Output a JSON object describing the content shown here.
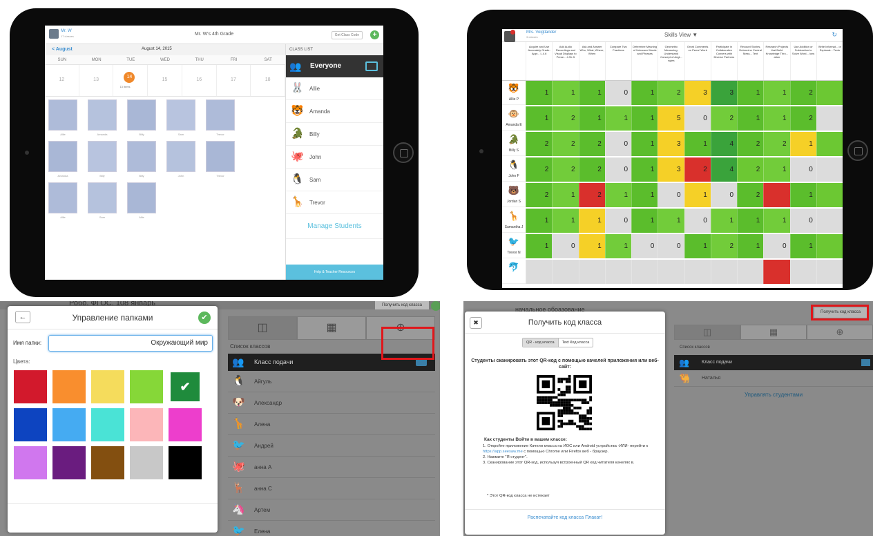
{
  "tl": {
    "teacher": "Mr. W",
    "teacher_sub": "17 classes",
    "title": "Mr. W's 4th Grade",
    "get_code": "Get Class Code",
    "back": "< August",
    "date": "August 14, 2015",
    "days": [
      "SUN",
      "MON",
      "TUE",
      "WED",
      "THU",
      "FRI",
      "SAT"
    ],
    "dates": [
      "12",
      "13",
      "14",
      "15",
      "16",
      "17",
      "18"
    ],
    "items": "13 items",
    "class_list": "CLASS LIST",
    "everyone": "Everyone",
    "students": [
      "Allie",
      "Amanda",
      "Billy",
      "John",
      "Sam",
      "Trevor"
    ],
    "student_icons": [
      "🐰",
      "🐯",
      "🐊",
      "🐙",
      "🐧",
      "🦒"
    ],
    "manage": "Manage Students",
    "help": "Help & Teacher Resources",
    "thumb_names": [
      "Allie",
      "Amanda",
      "Billy",
      "Sam",
      "Trevor",
      "",
      "Amanda",
      "Billy",
      "Billy",
      "John",
      "Trevor",
      "",
      "Allie",
      "Sam",
      "Allie"
    ]
  },
  "tr": {
    "teacher": "Mrs. Voigtlander",
    "classes": "3 classes",
    "view": "Skills View ▼",
    "refresh": "↻",
    "columns": [
      "Acquire and Use Accurately Grade-Appr... L.4.6",
      "Add Audio Recordings and Visual Displays to Prese... 4.SL.5",
      "Ask and Answer Who, What, Where, When",
      "Compare Two Fractions",
      "Determine Meaning of Unknown Words and Phrases",
      "Geometric Measuring: Understand Concept of Angl... ngles",
      "Great Comments on Peers' Work",
      "Participate in Collaborative Convers with Diverse Partners",
      "Recount Stories, Determine Central Mess... Text",
      "Research Projects that Build Knowledge Thro... ation",
      "Use Addition or Subtraction to Solve Word... ions",
      "Write Informat... or Explanat... Texts"
    ],
    "rows": [
      {
        "name": "Allie P",
        "icon": "🐯",
        "cells": [
          "1",
          "1",
          "1",
          "0",
          "1",
          "2",
          "3",
          "3",
          "1",
          "1",
          "2",
          ""
        ]
      },
      {
        "name": "Amanda E",
        "icon": "🐵",
        "cells": [
          "1",
          "2",
          "1",
          "1",
          "1",
          "5",
          "0",
          "2",
          "1",
          "1",
          "2",
          ""
        ]
      },
      {
        "name": "Billy S",
        "icon": "🐊",
        "cells": [
          "2",
          "2",
          "2",
          "0",
          "1",
          "3",
          "1",
          "4",
          "2",
          "2",
          "1",
          ""
        ]
      },
      {
        "name": "John F",
        "icon": "🐧",
        "cells": [
          "2",
          "2",
          "2",
          "0",
          "1",
          "3",
          "2",
          "4",
          "2",
          "1",
          "0",
          ""
        ]
      },
      {
        "name": "Jordan S",
        "icon": "🐻",
        "cells": [
          "2",
          "1",
          "2",
          "1",
          "1",
          "0",
          "1",
          "0",
          "2",
          "",
          "1",
          ""
        ]
      },
      {
        "name": "Samantha J",
        "icon": "🦒",
        "cells": [
          "1",
          "1",
          "1",
          "0",
          "1",
          "1",
          "0",
          "1",
          "1",
          "1",
          "0",
          ""
        ]
      },
      {
        "name": "Trevor N",
        "icon": "🐦",
        "cells": [
          "1",
          "0",
          "1",
          "1",
          "0",
          "0",
          "1",
          "2",
          "1",
          "0",
          "1",
          ""
        ]
      },
      {
        "name": "",
        "icon": "🐬",
        "cells": [
          "",
          "",
          "",
          "",
          "",
          "",
          "",
          "",
          "",
          "",
          "",
          ""
        ]
      }
    ]
  },
  "bl": {
    "header": "Робо. ФГОС. 108 январь",
    "get_code": "Получить код класса",
    "list_header": "Список классов",
    "everyone": "Класс подачи",
    "students": [
      "Айгуль",
      "Александр",
      "Алена",
      "Андрей",
      "анна А",
      "анна С",
      "Артем",
      "Елена"
    ],
    "student_icons": [
      "🐧",
      "🐶",
      "🦒",
      "🐦",
      "🐙",
      "🦌",
      "🦄",
      "🐦"
    ],
    "modal_title": "Управление папками",
    "folder_label": "Имя папки:",
    "folder_value": "Окружающий мир",
    "colors_label": "Цвета:",
    "colors": [
      "#d2192c",
      "#f98e2e",
      "#f5dc5c",
      "#86d738",
      "#1f8b3c",
      "#0d44c0",
      "#45abf2",
      "#4ae3d6",
      "#fcb6b9",
      "#ed3ecc",
      "#d077ee",
      "#6a1c7f",
      "#834f10",
      "#c8c8c8",
      "#000000"
    ],
    "selected_color": 4,
    "check": "✔",
    "ok": "✔",
    "back": "←"
  },
  "br": {
    "header": "начальное обоазование",
    "get_code": "Получить код класса",
    "tab_icons": [
      "◫",
      "▦",
      "⊕"
    ],
    "list_header": "Список классов",
    "everyone": "Класс подачи",
    "students": [
      "Наталья"
    ],
    "student_icons": [
      "🐫"
    ],
    "manage": "Управлять студентами",
    "modal_title": "Получить код класса",
    "close": "✖",
    "tab_qr": "QR - код класса",
    "tab_text": "Text Код класса",
    "instruction": "Студенты сканировать этот QR-код с помощью качелей приложения или веб-сайт:",
    "how": "Как студенты Войти в вашем классе:",
    "step1_a": "1. Откройте приложение Качели класса на ИОС или Android устройства -ИЛИ- перейти к ",
    "step1_link": "https://app.seesaw.me",
    "step1_b": " с помощью Chrome или Firefox веб - браузер.",
    "step2": "2. Нажмите \"Я студент\".",
    "step3": "3. Сканирование этот QR-код, используя встроенный QR код читателя качелях в.",
    "note": "* Этот QR-код класса не истекает",
    "poster": "Распечатайте код класса Плакат!"
  }
}
